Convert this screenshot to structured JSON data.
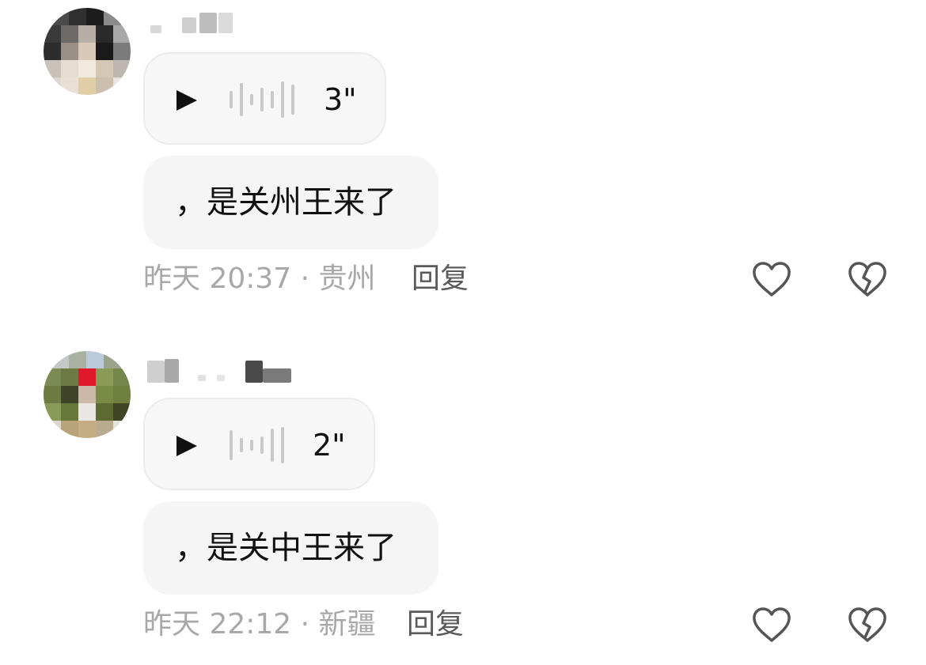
{
  "comments": [
    {
      "voice_duration": "3\"",
      "text": "，是关州王来了",
      "meta": "昨天 20:37 · 贵州",
      "reply_label": "回复",
      "like_icon": "heart-outline-icon",
      "dislike_icon": "broken-heart-icon"
    },
    {
      "voice_duration": "2\"",
      "text": "，是关中王来了",
      "meta": "昨天 22:12 · 新疆",
      "reply_label": "回复",
      "like_icon": "heart-outline-icon",
      "dislike_icon": "broken-heart-icon"
    }
  ],
  "colors": {
    "text_primary": "#111111",
    "text_meta": "#a8a8a8",
    "reply": "#5a5a5a",
    "bubble_bg": "#f5f5f5",
    "icon_stroke": "#555555"
  }
}
